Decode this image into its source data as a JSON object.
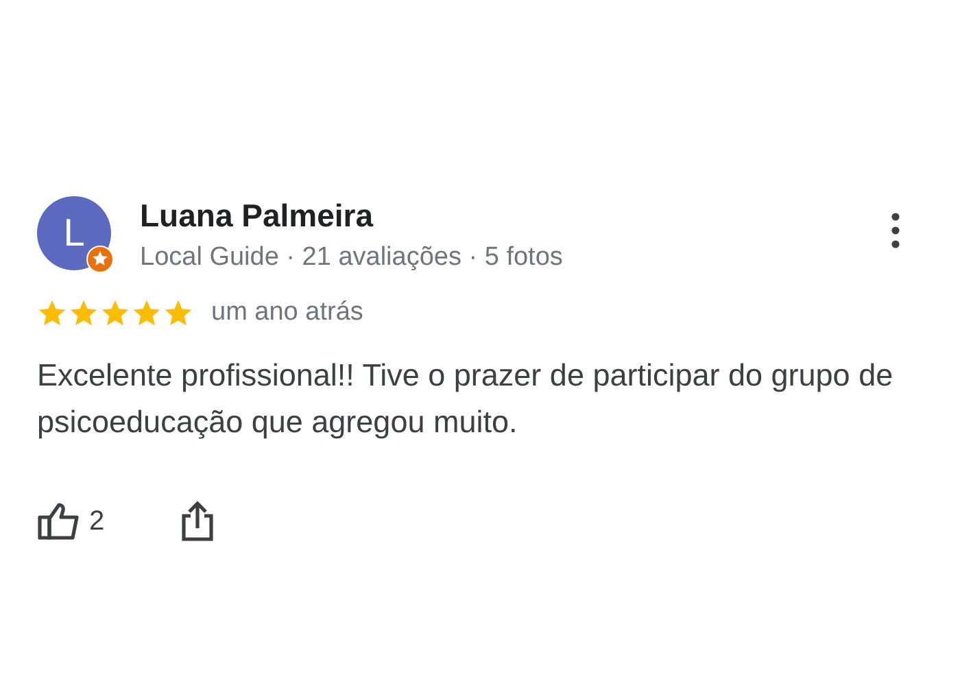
{
  "review": {
    "avatar_initial": "L",
    "author": "Luana Palmeira",
    "meta": "Local Guide · 21 avaliações · 5 fotos",
    "stars": 5,
    "time": "um ano atrás",
    "text": "Excelente profissional!! Tive o prazer de participar do grupo de psicoeducação que agregou muito.",
    "likes": "2"
  }
}
